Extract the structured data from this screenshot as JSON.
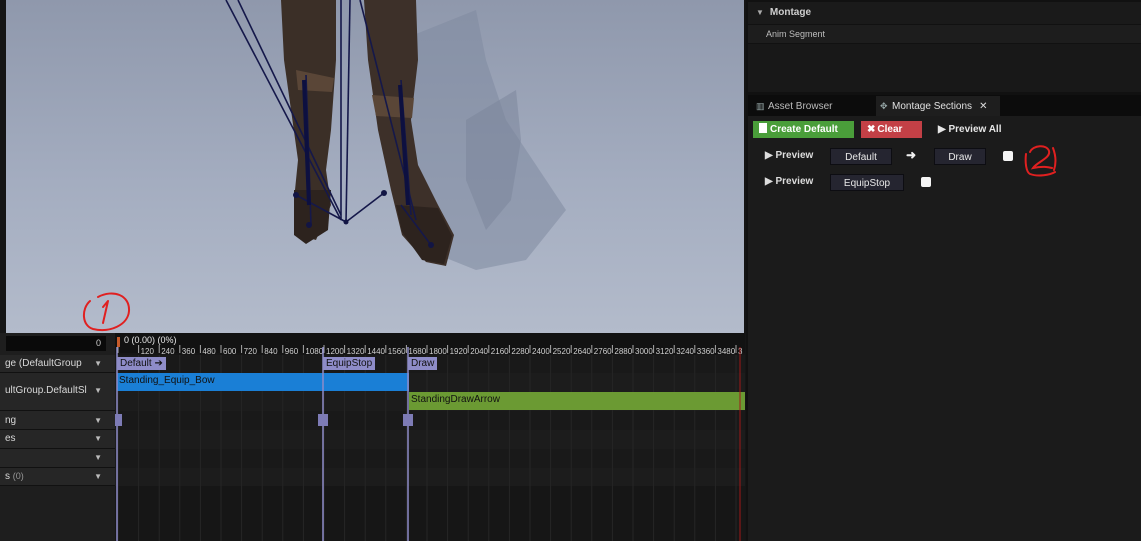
{
  "details": {
    "category": "Montage",
    "row_label": "Anim Segment"
  },
  "tabs": [
    {
      "label": "Asset Browser",
      "icon": "asset-browser-icon",
      "active": false
    },
    {
      "label": "Montage Sections",
      "icon": "montage-sections-icon",
      "active": true
    }
  ],
  "toolbar": {
    "create_default": "Create Default",
    "clear": "Clear",
    "preview_all": "Preview All"
  },
  "sections": [
    {
      "preview": "Preview",
      "from": "Default",
      "to": "Draw",
      "checked": false
    },
    {
      "preview": "Preview",
      "from": "EquipStop",
      "to": "",
      "checked": false
    }
  ],
  "timeline": {
    "zero": "0",
    "scrub_time": "0 (0.00) (0%)",
    "ticks": [
      "0",
      "120",
      "240",
      "360",
      "480",
      "600",
      "720",
      "840",
      "960",
      "1080",
      "1200",
      "1320",
      "1440",
      "1560",
      "1680",
      "1800",
      "1920",
      "2040",
      "2160",
      "2280",
      "2400",
      "2520",
      "2640",
      "2760",
      "2880",
      "3000",
      "3120",
      "3240",
      "3360",
      "3480",
      "3"
    ],
    "tracks": [
      {
        "label": "ge (DefaultGroup",
        "count": ""
      },
      {
        "label": "ultGroup.DefaultSl",
        "count": ""
      },
      {
        "label": "ng",
        "count": ""
      },
      {
        "label": "es",
        "count": ""
      },
      {
        "label": "",
        "count": ""
      },
      {
        "label": "s",
        "count": "(0)"
      }
    ],
    "section_tags": [
      "Default",
      "EquipStop",
      "Draw"
    ],
    "animations": [
      "Standing_Equip_Bow",
      "StandingDrawArrow"
    ],
    "colors": {
      "slot_bar": "#1a7fd6",
      "anim2_bar": "#6b9a33",
      "section_tag": "#8e8cc8"
    }
  },
  "annotations": [
    "1",
    "2"
  ]
}
